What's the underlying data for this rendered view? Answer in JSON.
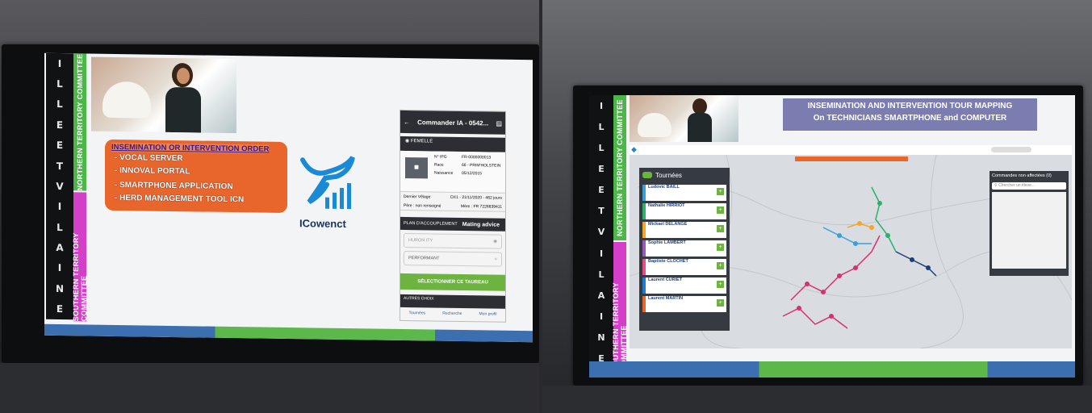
{
  "left": {
    "side_letters": [
      "I",
      "L",
      "L",
      "E",
      "E",
      "T",
      "V",
      "I",
      "L",
      "A",
      "I",
      "N",
      "E"
    ],
    "northern_label": "NORTHERN TERRITORY COMMITTEE",
    "southern_label": "SOUTHERN TERRITORY COMMITTEE",
    "order_title": "INSEMINATION OR INTERVENTION ORDER",
    "order_items": [
      "- VOCAL SERVER",
      "- INNOVAL PORTAL",
      "- SMARTPHONE APPLICATION",
      "- HERD MANAGEMENT TOOL ICN"
    ],
    "logo_text": "ICowenct",
    "phone": {
      "header": "Commander IA - 0542...",
      "section": "FEMELLE",
      "rows": [
        {
          "label": "N° IPG",
          "value": "FR-0000000013"
        },
        {
          "label": "Race",
          "value": "66 - PRIM'HOLSTEIN"
        },
        {
          "label": "Naissance",
          "value": "05/12/2015"
        }
      ],
      "dernier_velage_label": "Dernier Vêlage",
      "dernier_velage_value": "DX1 - 21/11/2020 - 462 jours",
      "pere_label": "Père : non renseigné",
      "mere_label": "Mère : FR 7226839411",
      "plan_label": "PLAN D'ACCOUPLEMENT",
      "mating_label": "Mating advice",
      "choices": [
        "HURON ITY",
        "PERFORMANT"
      ],
      "select_button": "SÉLECTIONNER CE TAUREAU",
      "autres_choix": "AUTRES CHOIX",
      "nav": [
        "Tournées",
        "Recherche",
        "Mon profil"
      ]
    }
  },
  "right": {
    "side_letters": [
      "I",
      "L",
      "L",
      "E",
      "E",
      "T",
      "V",
      "I",
      "L",
      "A",
      "I",
      "N",
      "E"
    ],
    "northern_label": "NORTHERN TERRITORY COMMITTEE",
    "southern_label": "SOUTHERN TERRITORY COMMITTEE",
    "title_line1": "INSEMINATION AND INTERVENTION TOUR MAPPING",
    "title_line2": "On TECHNICIANS SMARTPHONE and COMPUTER",
    "app_label": "Tournées",
    "unassigned_label": "Commandes non affectées (0)",
    "search_placeholder": "Chercher un éleve...",
    "tours": [
      "Ludovic BAILL",
      "Nathalie HIRRIOT",
      "Mickael DELANGE",
      "Sophie LAMBERT",
      "Baptiste CLOCHET",
      "Laurent CURIET",
      "Laurent MARTIN"
    ],
    "tour_colors": [
      "#3aa0d8",
      "#2cb06c",
      "#f2a62b",
      "#9b59b6",
      "#e84d8a",
      "#1f7ad0",
      "#e8652c"
    ]
  },
  "colors": {
    "north_green": "#4cb648",
    "south_magenta": "#d43fc8",
    "order_orange": "#e8652c",
    "map_bg": "#d9dde1"
  }
}
